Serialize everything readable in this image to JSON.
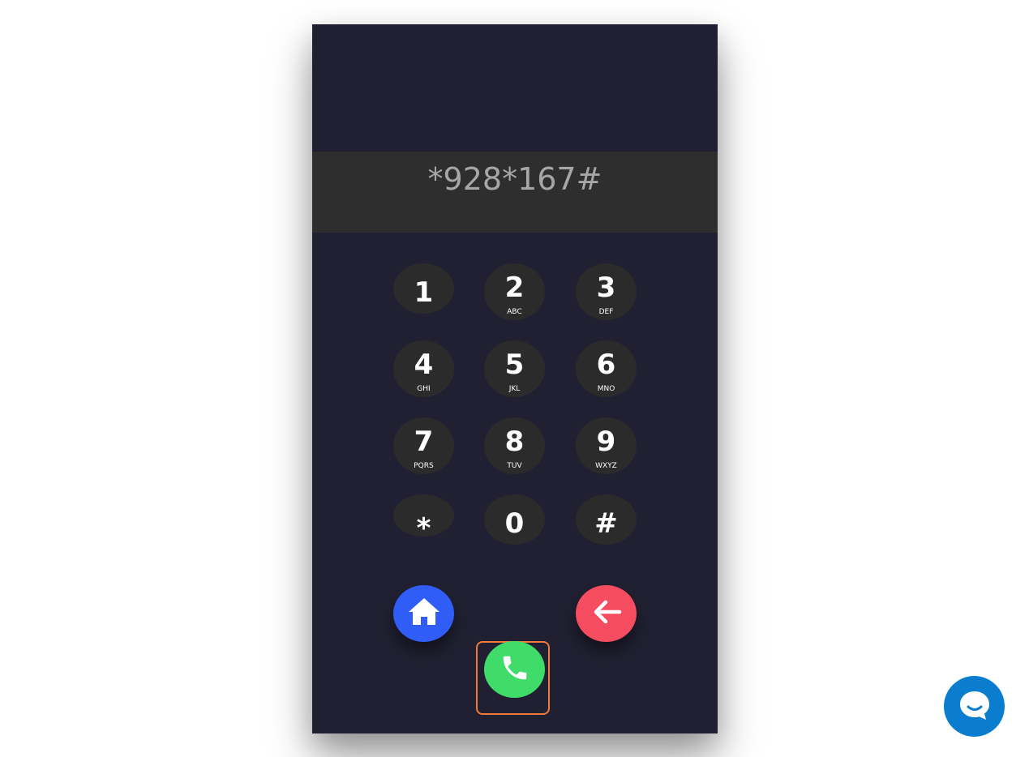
{
  "display": {
    "number": "*928*167#"
  },
  "keypad": [
    {
      "digit": "1",
      "letters": ""
    },
    {
      "digit": "2",
      "letters": "ABC"
    },
    {
      "digit": "3",
      "letters": "DEF"
    },
    {
      "digit": "4",
      "letters": "GHI"
    },
    {
      "digit": "5",
      "letters": "JKL"
    },
    {
      "digit": "6",
      "letters": "MNO"
    },
    {
      "digit": "7",
      "letters": "PQRS"
    },
    {
      "digit": "8",
      "letters": "TUV"
    },
    {
      "digit": "9",
      "letters": "WXYZ"
    },
    {
      "digit": "*",
      "letters": ""
    },
    {
      "digit": "0",
      "letters": ""
    },
    {
      "digit": "#",
      "letters": ""
    }
  ],
  "actions": {
    "home": {
      "icon": "home-icon",
      "color": "#2f5df5"
    },
    "call": {
      "icon": "phone-icon",
      "color": "#3fdc6a"
    },
    "back": {
      "icon": "arrow-left-icon",
      "color": "#f54c60"
    }
  },
  "chat": {
    "icon": "chat-bubble-icon",
    "color": "#0b7dcf"
  },
  "colors": {
    "phone_background": "#212032",
    "display_background": "#2e2e2e",
    "key_background": "#2b2b2b",
    "display_text": "#a6a6a6",
    "highlight": "#f07a3a"
  }
}
